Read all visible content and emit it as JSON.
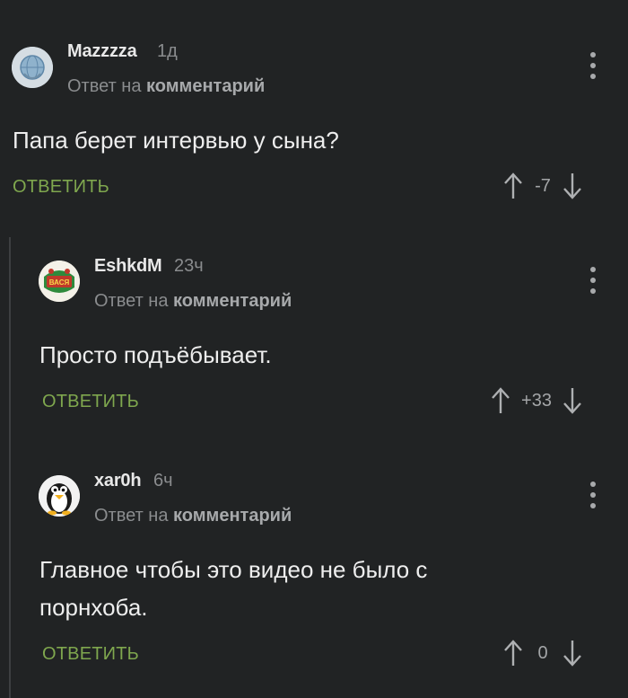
{
  "comments": [
    {
      "username": "Mazzzza",
      "time": "1д",
      "reply_prefix": "Ответ на",
      "reply_target": "комментарий",
      "text": "Папа берет интервью у сына?",
      "reply_label": "ОТВЕТИТЬ",
      "score": "-7"
    },
    {
      "username": "EshkdM",
      "time": "23ч",
      "reply_prefix": "Ответ на",
      "reply_target": "комментарий",
      "text": "Просто подъёбывает.",
      "reply_label": "ОТВЕТИТЬ",
      "score": "+33",
      "badge": "ВАСЯ"
    },
    {
      "username": "xar0h",
      "time": "6ч",
      "reply_prefix": "Ответ на",
      "reply_target": "комментарий",
      "text_line1": "Главное чтобы это видео не было с",
      "text_line2": "порнхоба.",
      "reply_label": "ОТВЕТИТЬ",
      "score": "0"
    }
  ],
  "colors": {
    "background": "#212324",
    "accent_green": "#7fa74e",
    "muted_text": "#8a8c8e",
    "badge_red": "#c0392b"
  },
  "icons": {
    "menu": "kebab-menu-icon",
    "upvote": "arrow-up-icon",
    "downvote": "arrow-down-icon"
  }
}
